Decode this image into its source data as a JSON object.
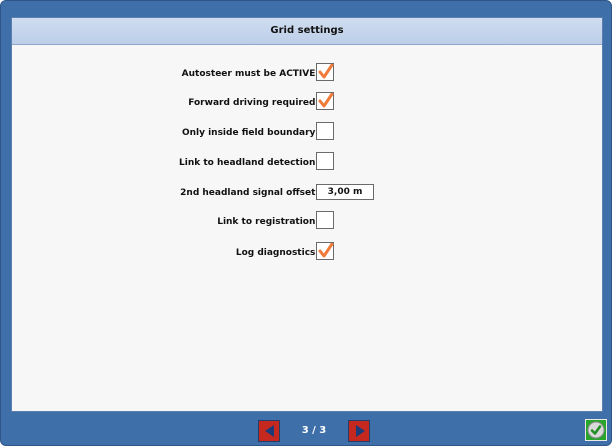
{
  "panel": {
    "title": "Grid settings"
  },
  "settings": [
    {
      "label": "Autosteer must be ACTIVE:",
      "type": "checkbox",
      "checked": true
    },
    {
      "label": "Forward driving required:",
      "type": "checkbox",
      "checked": true
    },
    {
      "label": "Only inside field boundary:",
      "type": "checkbox",
      "checked": false
    },
    {
      "label": "Link to headland detection:",
      "type": "checkbox",
      "checked": false
    },
    {
      "label": "2nd headland signal offset:",
      "type": "value",
      "value": "3,00 m"
    },
    {
      "label": "Link to registration:",
      "type": "checkbox",
      "checked": false
    },
    {
      "label": "Log diagnostics:",
      "type": "checkbox",
      "checked": true
    }
  ],
  "footer": {
    "page_indicator": "3 / 3"
  },
  "colors": {
    "frame": "#3f6fa8",
    "check_mark": "#f07a3a",
    "nav_button": "#c4281f",
    "ok_button": "#27a62b"
  },
  "icons": {
    "prev": "triangle-left-icon",
    "next": "triangle-right-icon",
    "ok": "checkmark-icon",
    "check": "check-icon"
  }
}
